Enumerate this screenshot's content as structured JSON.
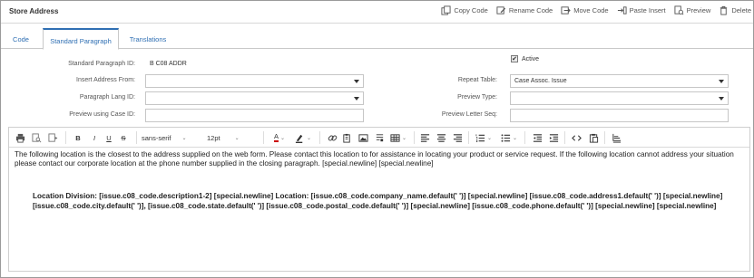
{
  "header": {
    "title": "Store Address",
    "actions": [
      {
        "label": "Copy Code",
        "icon": "copy-icon"
      },
      {
        "label": "Rename Code",
        "icon": "rename-icon"
      },
      {
        "label": "Move Code",
        "icon": "move-icon"
      },
      {
        "label": "Paste Insert",
        "icon": "paste-insert-icon"
      },
      {
        "label": "Preview",
        "icon": "preview-icon"
      },
      {
        "label": "Delete",
        "icon": "trash-icon"
      }
    ]
  },
  "tabs": [
    {
      "label": "Code",
      "active": false
    },
    {
      "label": "Standard Paragraph",
      "active": true
    },
    {
      "label": "Translations",
      "active": false
    }
  ],
  "form": {
    "active_label": "Active",
    "active_checked": true,
    "standard_paragraph_id_label": "Standard Paragraph ID:",
    "standard_paragraph_id_value": "B C08 ADDR",
    "insert_address_label": "Insert Address From:",
    "insert_address_value": "",
    "paragraph_lang_label": "Paragraph Lang ID:",
    "paragraph_lang_value": "",
    "preview_case_label": "Preview using Case ID:",
    "preview_case_value": "",
    "repeat_table_label": "Repeat Table:",
    "repeat_table_value": "Case Assoc. Issue",
    "preview_type_label": "Preview Type:",
    "preview_type_value": "",
    "preview_letter_label": "Preview Letter Seq:",
    "preview_letter_value": ""
  },
  "toolbar": {
    "font_family": "sans-serif",
    "font_size": "12pt",
    "bold": "B",
    "italic": "I",
    "underline": "U",
    "strike": "S",
    "text_color_letter": "A"
  },
  "content": {
    "paragraph": "The following location is the closest to the address supplied on the web form. Please contact this location to for assistance in locating your product or service request. If the following location cannot address your situation please contact our corporate location at the phone number supplied in the closing paragraph. [special.newline] [special.newline]",
    "location_block": "Location Division: [issue.c08_code.description1-2] [special.newline] Location: [issue.c08_code.company_name.default(' ')] [special.newline] [issue.c08_code.address1.default(' ')] [special.newline] [issue.c08_code.city.default(' ')], [issue.c08_code.state.default(' ')] [issue.c08_code.postal_code.default(' ')] [special.newline] [issue.c08_code.phone.default(' ')] [special.newline] [special.newline]"
  },
  "colors": {
    "accent": "#2f6fb3",
    "border": "#c6c6c6"
  }
}
